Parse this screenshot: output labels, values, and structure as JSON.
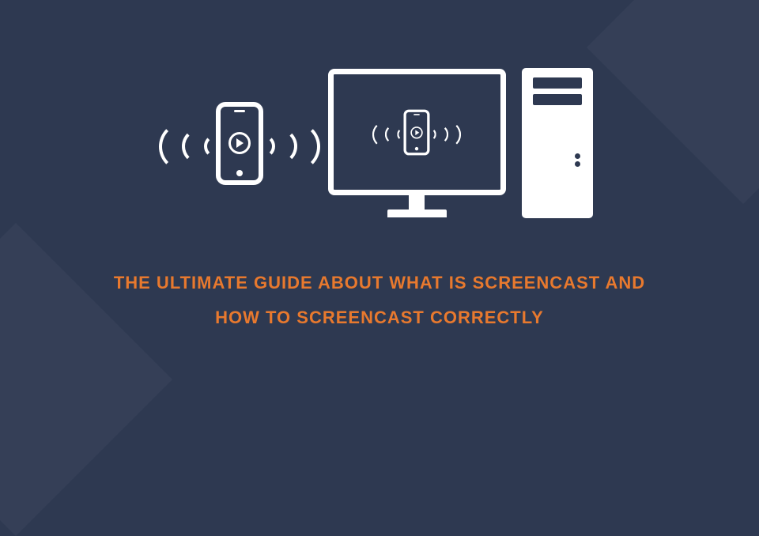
{
  "colors": {
    "background": "#2E3951",
    "accent_corner": "#353F57",
    "title": "#E8792E",
    "icon": "#FFFFFF"
  },
  "title": {
    "line1": "THE ULTIMATE GUIDE ABOUT WHAT IS SCREENCAST AND",
    "line2": "HOW TO SCREENCAST CORRECTLY"
  },
  "icons": {
    "phone": "phone-casting-icon",
    "monitor": "desktop-monitor-icon",
    "tower": "pc-tower-icon",
    "play": "play-button-icon",
    "waves": "broadcast-waves-icon"
  }
}
